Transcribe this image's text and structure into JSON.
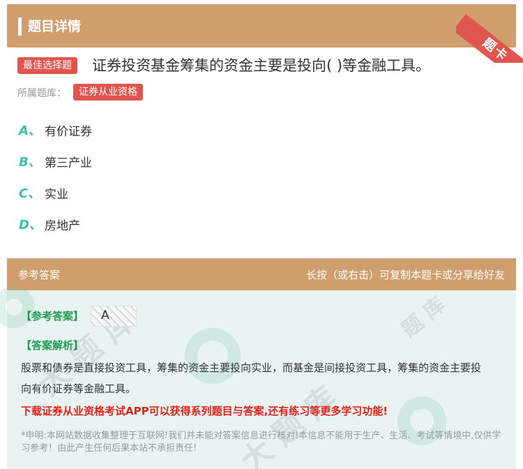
{
  "header": {
    "title": "题目详情",
    "ribbon_label": "题卡"
  },
  "question": {
    "type_tag": "最佳选择题",
    "text": "证券投资基金筹集的资金主要是投向( )等金融工具。",
    "category_label": "所属题库：",
    "category_tag": "证券从业资格"
  },
  "options": [
    {
      "letter": "A、",
      "text": "有价证券"
    },
    {
      "letter": "B、",
      "text": "第三产业"
    },
    {
      "letter": "C、",
      "text": "实业"
    },
    {
      "letter": "D、",
      "text": "房地产"
    }
  ],
  "answer_panel": {
    "head_left": "参考答案",
    "head_right": "长按（或右击）可复制本题卡或分享给好友",
    "answer_label": "【参考答案】",
    "answer_value": "A",
    "analysis_label": "【答案解析】",
    "analysis_text": "股票和债券是直接投资工具，筹集的资金主要投向实业，而基金是间接投资工具，筹集的资金主要投向有价证券等金融工具。",
    "promo": "下载证券从业资格考试APP可以获得系列题目与答案,还有练习等更多学习功能!",
    "disclaimer": "*申明:本网站数据收集整理于互联网!我们并未能对答案信息进行核对!本信息不能用于生产、生活、考试等情境中,仅供学习参考！由此产生任何后果本站不承担责任!"
  },
  "colors": {
    "header_bg": "#cf9e6c",
    "tag_red": "#e0564e",
    "option_letter": "#3bbfb2",
    "answer_label": "#1f9b55",
    "promo": "#e0231a",
    "panel_bg": "#e9f4f2"
  }
}
